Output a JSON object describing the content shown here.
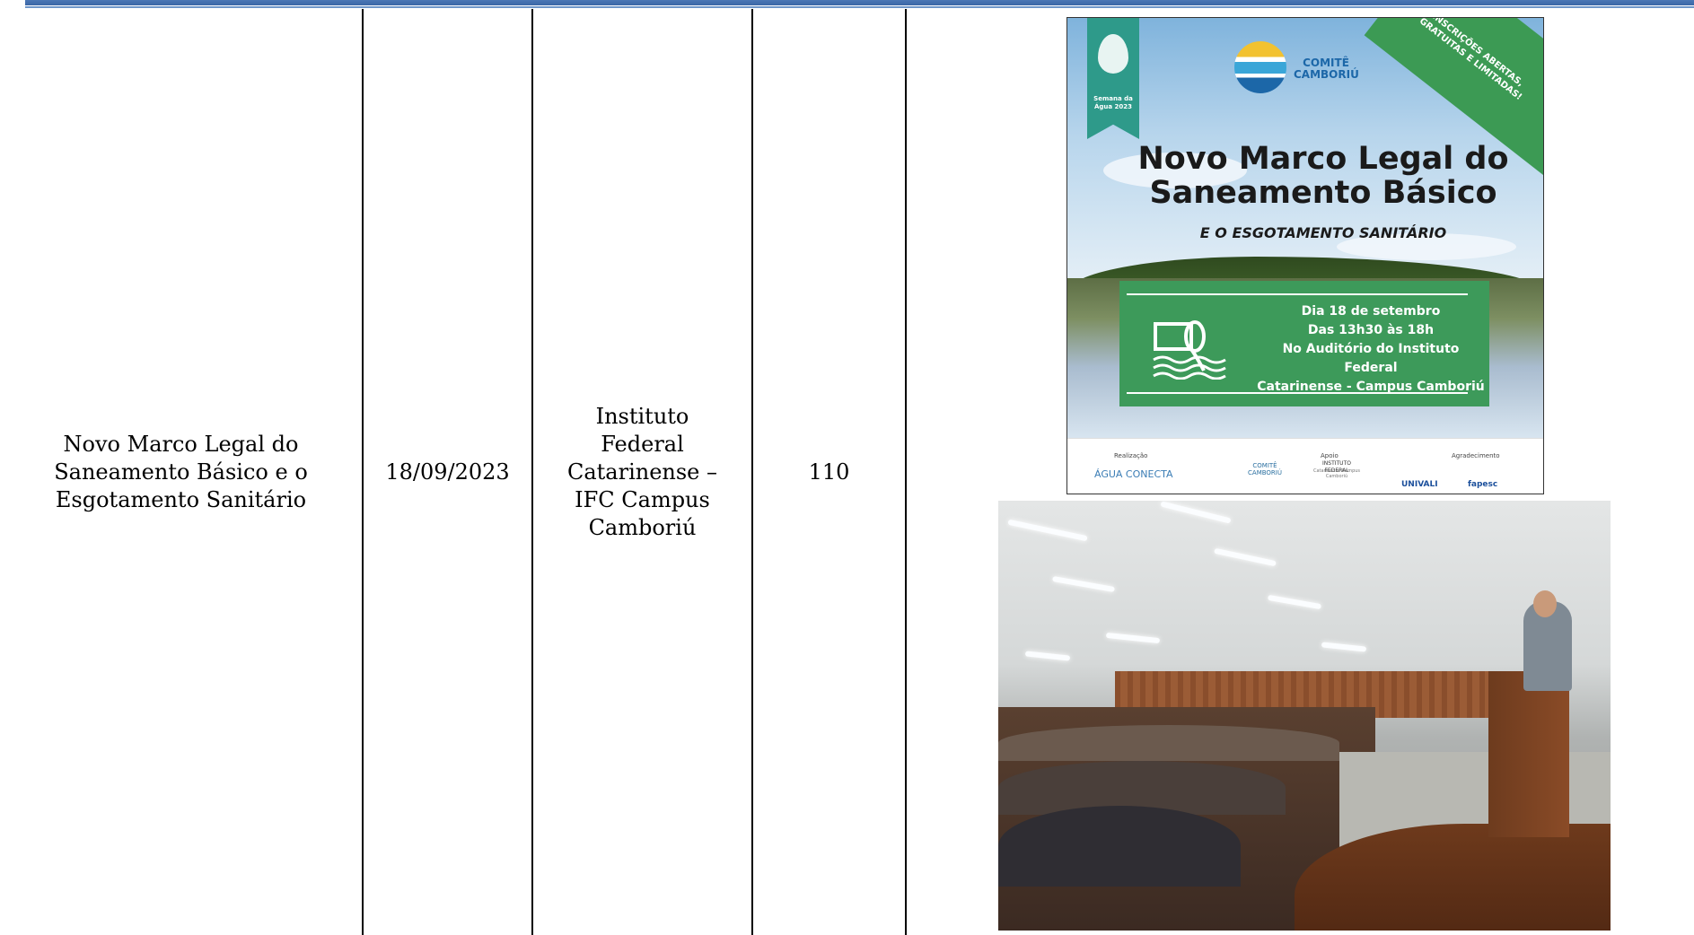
{
  "row": {
    "event_name": "Novo Marco Legal do Saneamento Básico e o Esgotamento Sanitário",
    "date": "18/09/2023",
    "location": "Instituto Federal Catarinense – IFC Campus Camboriú",
    "participants": "110"
  },
  "poster": {
    "ribbon_text": "Semana da Água 2023",
    "org_name": "COMITÊ CAMBORIÚ",
    "corner_banner": "INSCRIÇÕES ABERTAS, GRATUITAS E LIMITADAS!",
    "title": "Novo Marco Legal do Saneamento Básico",
    "subtitle": "E O ESGOTAMENTO SANITÁRIO",
    "info_lines": [
      "Dia 18 de setembro",
      "Das 13h30 às 18h",
      "No Auditório do Instituto Federal",
      "Catarinense - Campus Camboriú"
    ],
    "footer": {
      "label_realizacao": "Realização",
      "label_apoio": "Apoio",
      "label_agradecimento": "Agradecimento",
      "logo_agua_conecta": "ÁGUA CONECTA",
      "logo_comite": "COMITÊ CAMBORIÚ",
      "logo_if": "INSTITUTO FEDERAL",
      "logo_if_sub": "Catarinense Campus Camboriú",
      "logo_univali": "UNIVALI",
      "logo_fapesc": "fapesc"
    }
  },
  "colors": {
    "poster_green": "#3d9a5a",
    "comite_blue": "#1c67a8",
    "header_bar": "#4b77b5"
  }
}
